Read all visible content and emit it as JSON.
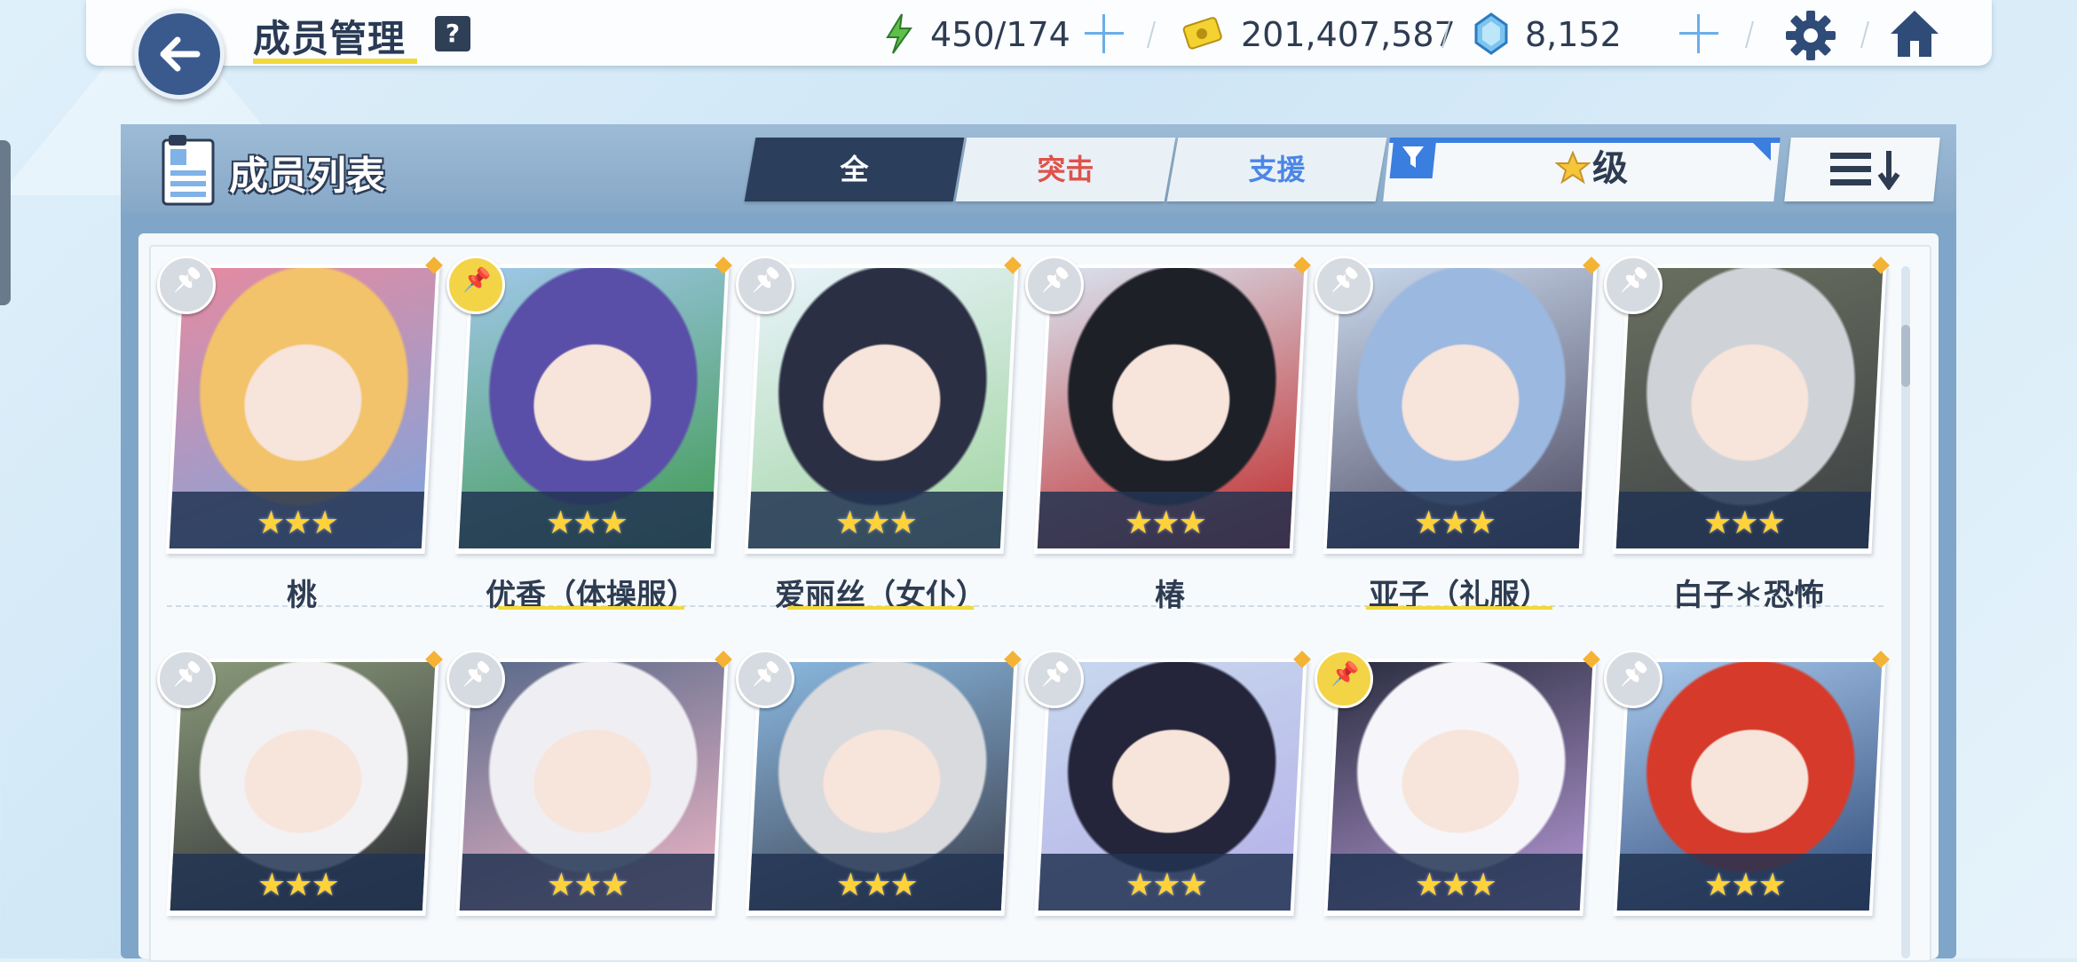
{
  "header": {
    "title": "成员管理",
    "help": "?",
    "stamina": "450/174",
    "credits": "201,407,587",
    "gems": "8,152"
  },
  "panel": {
    "title": "成员列表",
    "tabs": [
      {
        "label": "全",
        "color": "#ffffff"
      },
      {
        "label": "突击",
        "color": "#e0524a"
      },
      {
        "label": "支援",
        "color": "#4c86e6"
      }
    ],
    "filter_label": "级"
  },
  "members": [
    {
      "name": "桃",
      "stars": "★★★",
      "pinned": false,
      "palette": [
        "#f2c36a",
        "#7aa6e0",
        "#e68aa0"
      ]
    },
    {
      "name": "优香（体操服）",
      "stars": "★★★",
      "pinned": true,
      "palette": [
        "#5a4fa8",
        "#3f9a52",
        "#9fc7e8"
      ]
    },
    {
      "name": "爱丽丝（女仆）",
      "stars": "★★★",
      "pinned": false,
      "palette": [
        "#2b2f44",
        "#9fd49f",
        "#e9f3fb"
      ]
    },
    {
      "name": "椿",
      "stars": "★★★",
      "pinned": false,
      "palette": [
        "#1e2028",
        "#c02a2a",
        "#d8e3f0"
      ]
    },
    {
      "name": "亚子（礼服）",
      "stars": "★★★",
      "pinned": false,
      "palette": [
        "#9ab8e0",
        "#4b4860",
        "#c9d8ec"
      ]
    },
    {
      "name": "白子＊恐怖",
      "stars": "★★★",
      "pinned": false,
      "palette": [
        "#cfd2d6",
        "#3c4044",
        "#6a7060"
      ]
    },
    {
      "name": "",
      "stars": "★★★",
      "pinned": false,
      "palette": [
        "#f2f2f4",
        "#2a2a32",
        "#8a9a7a"
      ]
    },
    {
      "name": "",
      "stars": "★★★",
      "pinned": false,
      "palette": [
        "#efeef2",
        "#f2b8c8",
        "#5a6a8a"
      ]
    },
    {
      "name": "",
      "stars": "★★★",
      "pinned": false,
      "palette": [
        "#d9dadd",
        "#3a3d4a",
        "#8ab8e0"
      ]
    },
    {
      "name": "",
      "stars": "★★★",
      "pinned": false,
      "palette": [
        "#24243a",
        "#b4b0e8",
        "#c8d8ee"
      ]
    },
    {
      "name": "",
      "stars": "★★★",
      "pinned": true,
      "palette": [
        "#f6f6fa",
        "#b89ad8",
        "#2a2e40"
      ]
    },
    {
      "name": "",
      "stars": "★★★",
      "pinned": false,
      "palette": [
        "#d63a2a",
        "#2e4a78",
        "#a8c8ec"
      ]
    }
  ]
}
